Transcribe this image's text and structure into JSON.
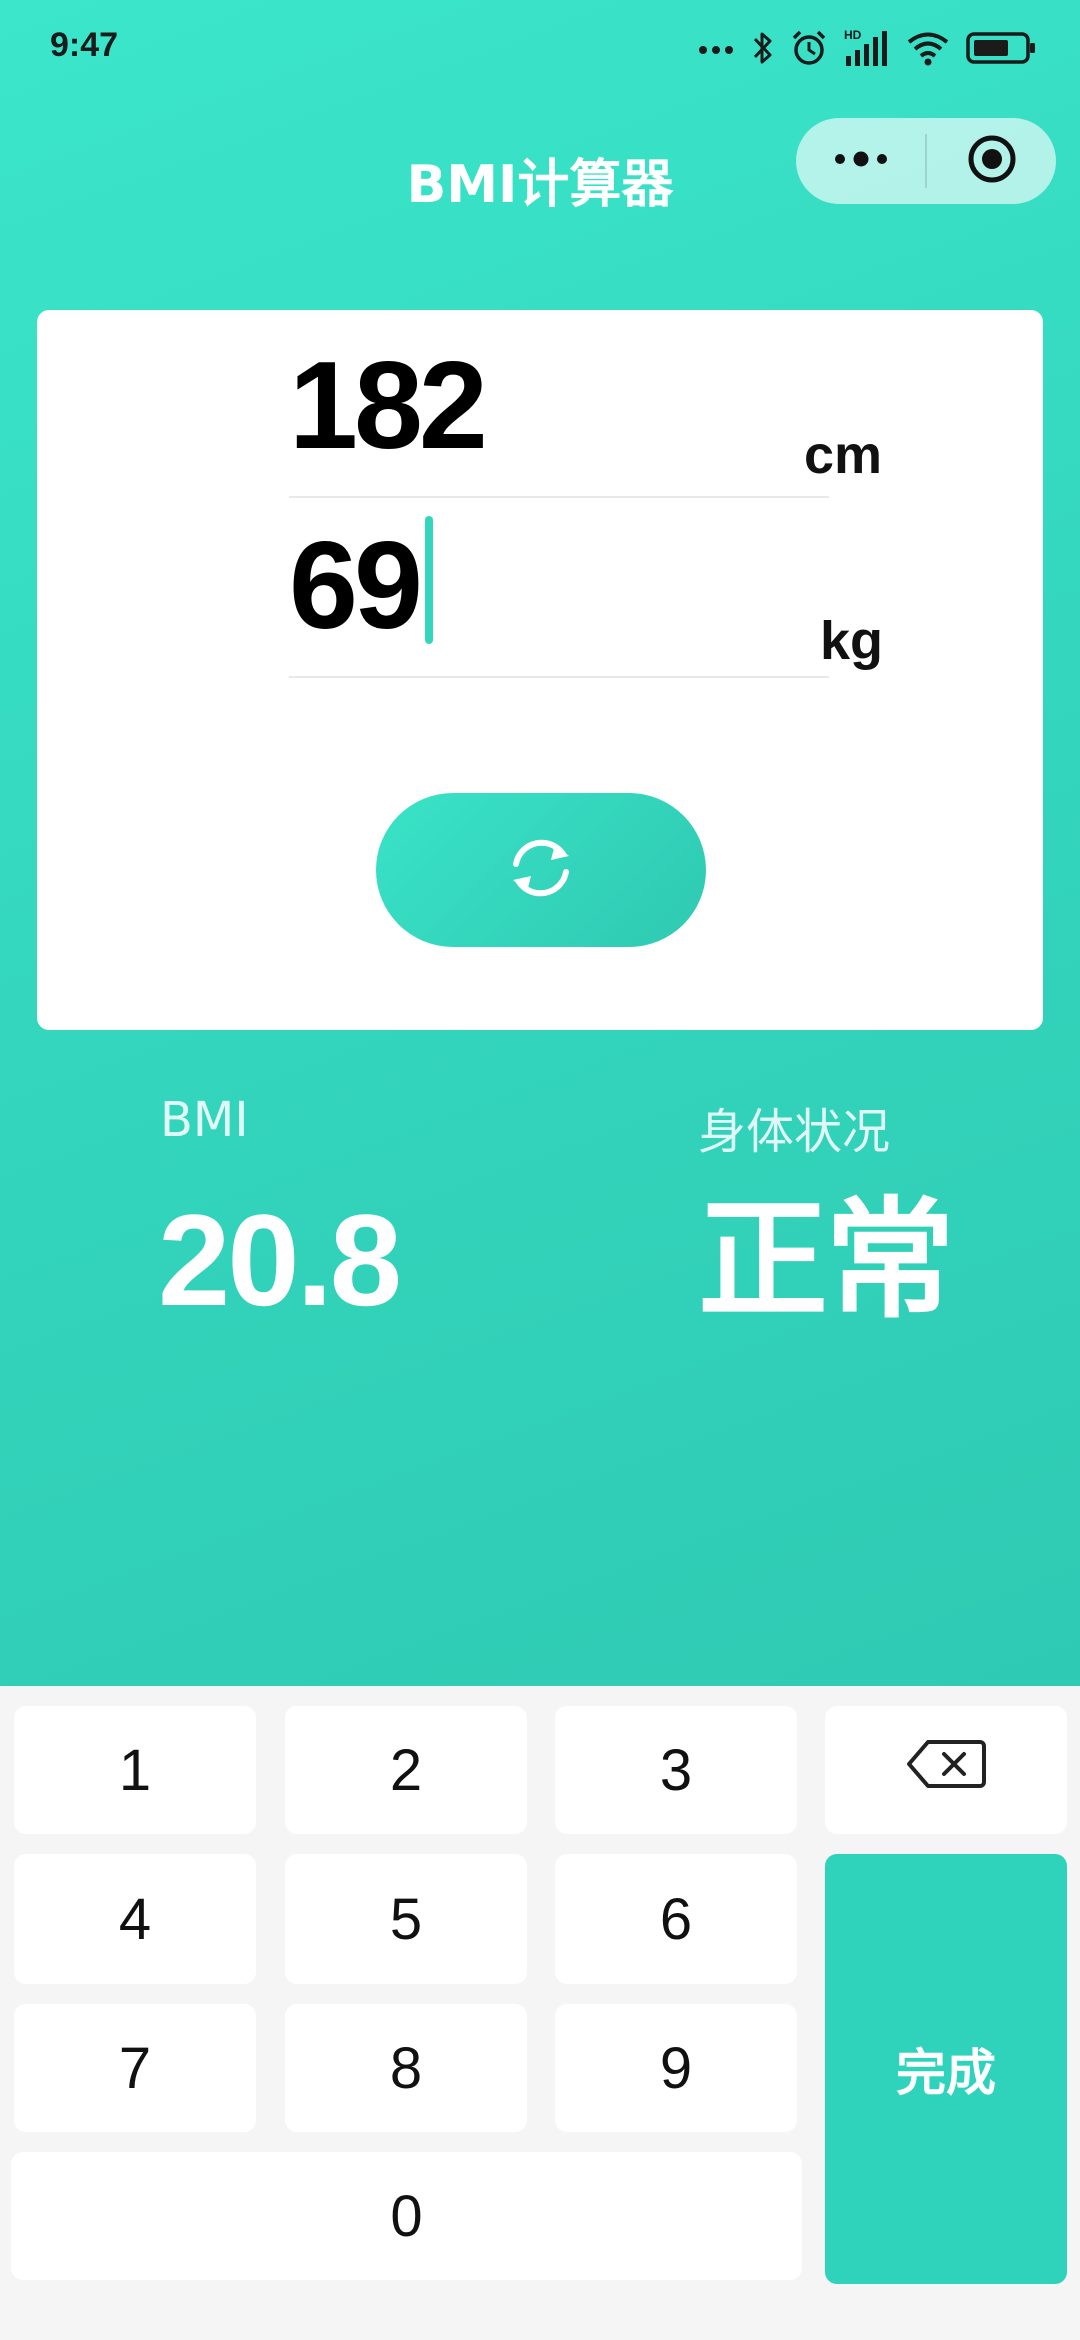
{
  "status_bar": {
    "time": "9:47",
    "icons": [
      "more-dots-icon",
      "bluetooth-icon",
      "alarm-icon",
      "hd-signal-icon",
      "wifi-icon",
      "battery-icon"
    ],
    "hd_text": "HD"
  },
  "nav": {
    "title": "BMI计算器",
    "capsule_icons": [
      "more-icon",
      "close-target-icon"
    ]
  },
  "form": {
    "height_value": "182",
    "height_unit": "cm",
    "weight_value": "69",
    "weight_unit": "kg",
    "calculate_icon": "refresh-icon"
  },
  "result": {
    "bmi_label": "BMI",
    "bmi_value": "20.8",
    "status_label": "身体状况",
    "status_value": "正常"
  },
  "keypad": {
    "keys": [
      "1",
      "2",
      "3",
      "4",
      "5",
      "6",
      "7",
      "8",
      "9",
      "0"
    ],
    "backspace_icon": "backspace-icon",
    "done_label": "完成"
  },
  "colors": {
    "accent": "#33d5bc",
    "accent_light": "#3be6ca",
    "done_key": "#2fd3bb",
    "keypad_bg": "#f5f5f5"
  }
}
